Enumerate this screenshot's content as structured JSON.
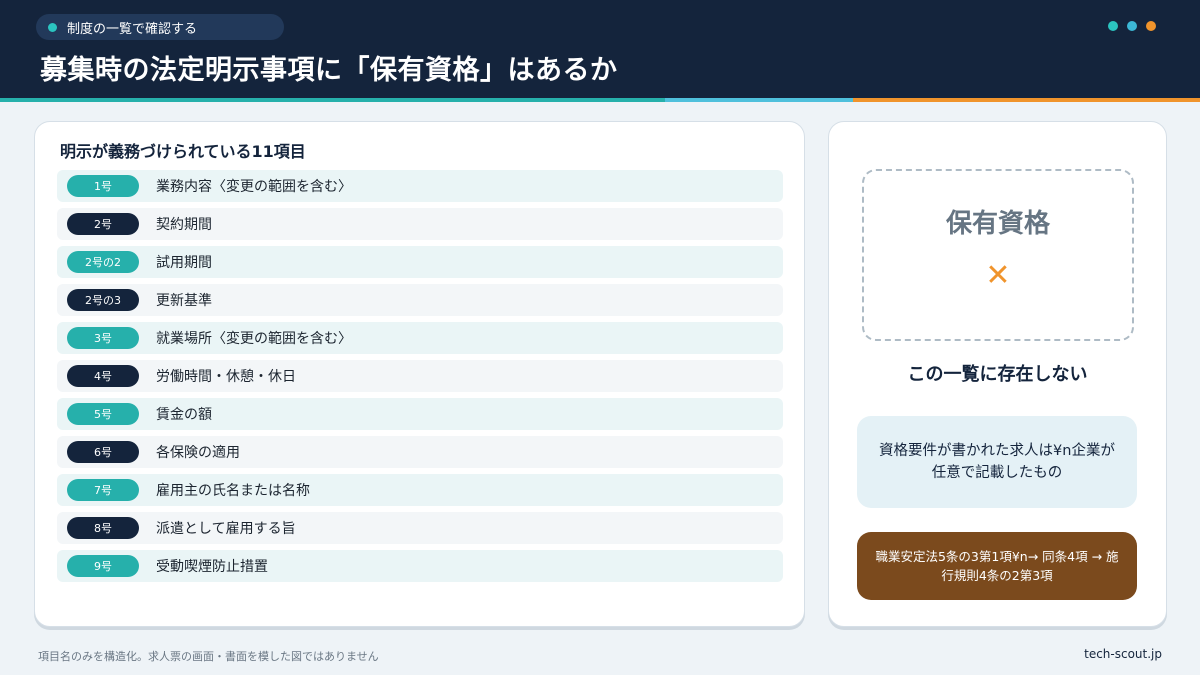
{
  "header": {
    "pill_text": "制度の一覧で確認する",
    "title": "募集時の法定明示事項に「保有資格」はあるか",
    "dot_colors": [
      "#2bc4c0",
      "#3cb8d6",
      "#f0942c"
    ]
  },
  "stripe_colors": [
    "#26b0ab",
    "#4fc0dc",
    "#f0942c"
  ],
  "list": {
    "title": "明示が義務づけられている11項目",
    "items": [
      {
        "badge": "1号",
        "label": "業務内容〈変更の範囲を含む〉",
        "style": "teal"
      },
      {
        "badge": "2号",
        "label": "契約期間",
        "style": "navy"
      },
      {
        "badge": "2号の2",
        "label": "試用期間",
        "style": "teal"
      },
      {
        "badge": "2号の3",
        "label": "更新基準",
        "style": "navy"
      },
      {
        "badge": "3号",
        "label": "就業場所〈変更の範囲を含む〉",
        "style": "teal"
      },
      {
        "badge": "4号",
        "label": "労働時間・休憩・休日",
        "style": "navy"
      },
      {
        "badge": "5号",
        "label": "賃金の額",
        "style": "teal"
      },
      {
        "badge": "6号",
        "label": "各保険の適用",
        "style": "navy"
      },
      {
        "badge": "7号",
        "label": "雇用主の氏名または名称",
        "style": "teal"
      },
      {
        "badge": "8号",
        "label": "派遣として雇用する旨",
        "style": "navy"
      },
      {
        "badge": "9号",
        "label": "受動喫煙防止措置",
        "style": "teal"
      }
    ]
  },
  "result": {
    "box_title": "保有資格",
    "cross_symbol": "✕",
    "not_exist": "この一覧に存在しない",
    "note": "資格要件が書かれた求人は¥n企業が任意で記載したもの",
    "law": "職業安定法5条の3第1項¥n→ 同条4項 → 施行規則4条の2第3項"
  },
  "footer": {
    "note": "項目名のみを構造化。求人票の画面・書面を模した図ではありません",
    "site": "tech-scout.jp"
  },
  "colors": {
    "navy": "#14243c",
    "teal": "#26b0ab",
    "orange": "#f0942c",
    "brown": "#7b4a1d"
  }
}
